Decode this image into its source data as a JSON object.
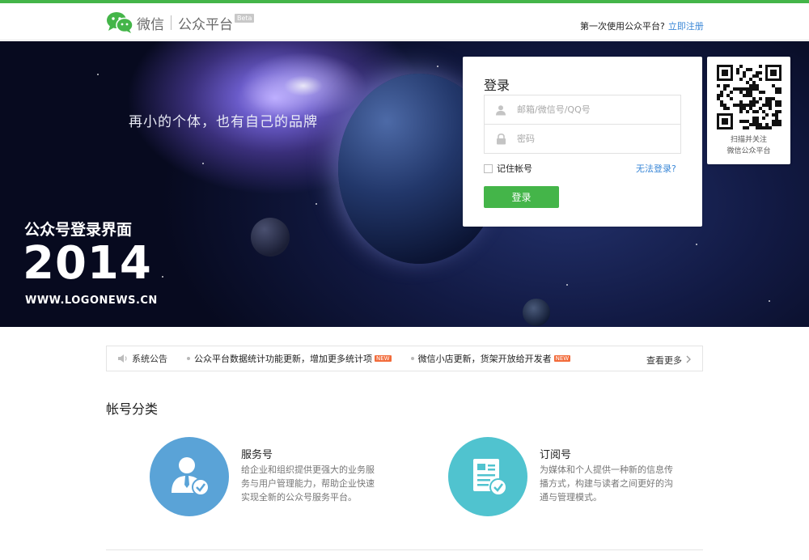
{
  "header": {
    "logo_primary": "微信",
    "logo_secondary": "公众平台",
    "logo_badge": "Beta",
    "first_time_prompt": "第一次使用公众平台?",
    "register_link": "立即注册"
  },
  "banner": {
    "slogan": "再小的个体，也有自己的品牌",
    "promo_title": "公众号登录界面",
    "promo_year": "2014",
    "promo_site": "WWW.LOGONEWS.CN"
  },
  "login": {
    "title": "登录",
    "account_placeholder": "邮箱/微信号/QQ号",
    "account_value": "",
    "password_placeholder": "密码",
    "password_value": "",
    "remember_label": "记住帐号",
    "remember_checked": false,
    "forgot_link": "无法登录?",
    "submit_label": "登录"
  },
  "qr": {
    "caption_line1": "扫描并关注",
    "caption_line2": "微信公众平台"
  },
  "notice": {
    "label": "系统公告",
    "items": [
      {
        "text": "公众平台数据统计功能更新，增加更多统计项",
        "badge": "NEW"
      },
      {
        "text": "微信小店更新，货架开放给开发者",
        "badge": "NEW"
      }
    ],
    "more_label": "查看更多"
  },
  "accounts": {
    "section_title": "帐号分类",
    "items": [
      {
        "name": "服务号",
        "desc": "给企业和组织提供更强大的业务服务与用户管理能力，帮助企业快速实现全新的公众号服务平台。",
        "icon": "service-user-icon",
        "color": "#5aa3d7"
      },
      {
        "name": "订阅号",
        "desc": "为媒体和个人提供一种新的信息传播方式，构建与读者之间更好的沟通与管理模式。",
        "icon": "subscription-doc-icon",
        "color": "#50c3cf"
      }
    ]
  },
  "colors": {
    "brand_green": "#44b549",
    "link_blue": "#3a87d7"
  }
}
